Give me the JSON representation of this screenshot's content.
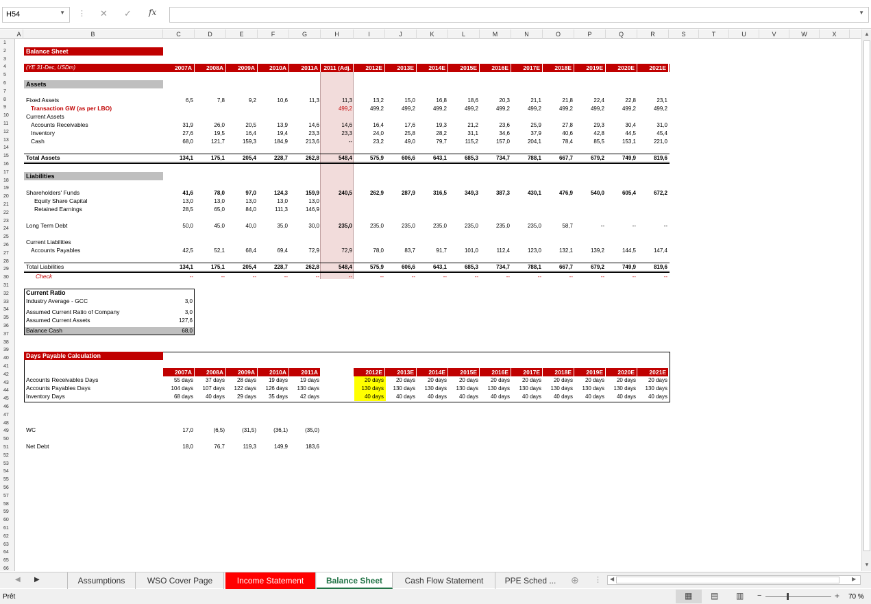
{
  "formula_bar": {
    "cell_ref": "H54",
    "fx": "fx",
    "value": ""
  },
  "columns": [
    "A",
    "B",
    "C",
    "D",
    "E",
    "F",
    "G",
    "H",
    "I",
    "J",
    "K",
    "L",
    "M",
    "N",
    "O",
    "P",
    "Q",
    "R",
    "S",
    "T",
    "U",
    "V",
    "W",
    "X"
  ],
  "rows": [
    "1",
    "2",
    "3",
    "4",
    "5",
    "6",
    "7",
    "8",
    "9",
    "10",
    "11",
    "12",
    "13",
    "14",
    "15",
    "16",
    "17",
    "18",
    "19",
    "20",
    "21",
    "22",
    "23",
    "24",
    "25",
    "26",
    "27",
    "28",
    "29",
    "30",
    "31",
    "32",
    "33",
    "34",
    "35",
    "36",
    "37",
    "38",
    "39",
    "40",
    "41",
    "42",
    "43",
    "44",
    "45",
    "46",
    "47",
    "48",
    "49",
    "50",
    "51",
    "52",
    "53",
    "54",
    "55",
    "56",
    "57",
    "58",
    "59",
    "60",
    "61",
    "62",
    "63",
    "64",
    "65",
    "66"
  ],
  "sheet": {
    "title": "Balance Sheet",
    "units": "(YE 31-Dec, USDm)",
    "years": [
      "2007A",
      "2008A",
      "2009A",
      "2010A",
      "2011A",
      "2011 (Adj.",
      "2012E",
      "2013E",
      "2014E",
      "2015E",
      "2016E",
      "2017E",
      "2018E",
      "2019E",
      "2020E",
      "2021E"
    ],
    "assets_label": "Assets",
    "fixed_assets": {
      "label": "Fixed Assets",
      "values": [
        "6,5",
        "7,8",
        "9,2",
        "10,6",
        "11,3",
        "11,3",
        "13,2",
        "15,0",
        "16,8",
        "18,6",
        "20,3",
        "21,1",
        "21,8",
        "22,4",
        "22,8",
        "23,1"
      ]
    },
    "transaction_gw": {
      "label": "Transaction GW (as per LBO)",
      "values": [
        "",
        "",
        "",
        "",
        "",
        "499,2",
        "499,2",
        "499,2",
        "499,2",
        "499,2",
        "499,2",
        "499,2",
        "499,2",
        "499,2",
        "499,2",
        "499,2"
      ]
    },
    "current_assets_label": "Current Assets",
    "receivables": {
      "label": "Accounts Receivables",
      "values": [
        "31,9",
        "26,0",
        "20,5",
        "13,9",
        "14,6",
        "14,6",
        "16,4",
        "17,6",
        "19,3",
        "21,2",
        "23,6",
        "25,9",
        "27,8",
        "29,3",
        "30,4",
        "31,0"
      ]
    },
    "inventory": {
      "label": "Inventory",
      "values": [
        "27,6",
        "19,5",
        "16,4",
        "19,4",
        "23,3",
        "23,3",
        "24,0",
        "25,8",
        "28,2",
        "31,1",
        "34,6",
        "37,9",
        "40,6",
        "42,8",
        "44,5",
        "45,4"
      ]
    },
    "cash": {
      "label": "Cash",
      "values": [
        "68,0",
        "121,7",
        "159,3",
        "184,9",
        "213,6",
        "--",
        "23,2",
        "49,0",
        "79,7",
        "115,2",
        "157,0",
        "204,1",
        "78,4",
        "85,5",
        "153,1",
        "221,0"
      ]
    },
    "total_assets": {
      "label": "Total Assets",
      "values": [
        "134,1",
        "175,1",
        "205,4",
        "228,7",
        "262,8",
        "548,4",
        "575,9",
        "606,6",
        "643,1",
        "685,3",
        "734,7",
        "788,1",
        "667,7",
        "679,2",
        "749,9",
        "819,6"
      ]
    },
    "liabilities_label": "Liabilities",
    "sh_funds": {
      "label": "Shareholders' Funds",
      "values": [
        "41,6",
        "78,0",
        "97,0",
        "124,3",
        "159,9",
        "240,5",
        "262,9",
        "287,9",
        "316,5",
        "349,3",
        "387,3",
        "430,1",
        "476,9",
        "540,0",
        "605,4",
        "672,2"
      ]
    },
    "equity_capital": {
      "label": "Equity Share Capital",
      "values": [
        "13,0",
        "13,0",
        "13,0",
        "13,0",
        "13,0"
      ]
    },
    "retained": {
      "label": "Retained Earnings",
      "values": [
        "28,5",
        "65,0",
        "84,0",
        "111,3",
        "146,9"
      ]
    },
    "ltd": {
      "label": "Long Term Debt",
      "values": [
        "50,0",
        "45,0",
        "40,0",
        "35,0",
        "30,0",
        "235,0",
        "235,0",
        "235,0",
        "235,0",
        "235,0",
        "235,0",
        "235,0",
        "58,7",
        "--",
        "--",
        "--"
      ]
    },
    "current_liab_label": "Current Liabilities",
    "payables": {
      "label": "Accounts Payables",
      "values": [
        "42,5",
        "52,1",
        "68,4",
        "69,4",
        "72,9",
        "72,9",
        "78,0",
        "83,7",
        "91,7",
        "101,0",
        "112,4",
        "123,0",
        "132,1",
        "139,2",
        "144,5",
        "147,4"
      ]
    },
    "total_liab": {
      "label": "Total Liabilities",
      "values": [
        "134,1",
        "175,1",
        "205,4",
        "228,7",
        "262,8",
        "548,4",
        "575,9",
        "606,6",
        "643,1",
        "685,3",
        "734,7",
        "788,1",
        "667,7",
        "679,2",
        "749,9",
        "819,6"
      ]
    },
    "check": {
      "label": "Check",
      "values": [
        "--",
        "--",
        "--",
        "--",
        "--",
        "--",
        "--",
        "--",
        "--",
        "--",
        "--",
        "--",
        "--",
        "--",
        "--",
        "--"
      ]
    }
  },
  "current_ratio": {
    "title": "Current Ratio",
    "industry": {
      "label": "Industry Average - GCC",
      "value": "3,0"
    },
    "assumed_ratio": {
      "label": "Assumed Current Ratio of Company",
      "value": "3,0"
    },
    "assumed_assets": {
      "label": "Assumed Current Assets",
      "value": "127,6"
    },
    "balance_cash": {
      "label": "Balance Cash",
      "value": "68,0"
    }
  },
  "days_payable": {
    "title": "Days Payable Calculation",
    "hist_years": [
      "2007A",
      "2008A",
      "2009A",
      "2010A",
      "2011A"
    ],
    "proj_years": [
      "2012E",
      "2013E",
      "2014E",
      "2015E",
      "2016E",
      "2017E",
      "2018E",
      "2019E",
      "2020E",
      "2021E"
    ],
    "recv": {
      "label": "Accounts Receivables Days",
      "hist": [
        "55 days",
        "37 days",
        "28 days",
        "19 days",
        "19 days"
      ],
      "proj": [
        "20 days",
        "20 days",
        "20 days",
        "20 days",
        "20 days",
        "20 days",
        "20 days",
        "20 days",
        "20 days",
        "20 days"
      ]
    },
    "pay": {
      "label": "Accounts Payables Days",
      "hist": [
        "104 days",
        "107 days",
        "122 days",
        "126 days",
        "130 days"
      ],
      "proj": [
        "130 days",
        "130 days",
        "130 days",
        "130 days",
        "130 days",
        "130 days",
        "130 days",
        "130 days",
        "130 days",
        "130 days"
      ]
    },
    "inv": {
      "label": "Inventory Days",
      "hist": [
        "68 days",
        "40 days",
        "29 days",
        "35 days",
        "42 days"
      ],
      "proj": [
        "40 days",
        "40 days",
        "40 days",
        "40 days",
        "40 days",
        "40 days",
        "40 days",
        "40 days",
        "40 days",
        "40 days"
      ]
    }
  },
  "wc": {
    "label": "WC",
    "values": [
      "17,0",
      "(6,5)",
      "(31,5)",
      "(36,1)",
      "(35,0)"
    ]
  },
  "net_debt": {
    "label": "Net Debt",
    "values": [
      "18,0",
      "76,7",
      "119,3",
      "149,9",
      "183,6"
    ]
  },
  "tabs": [
    "Assumptions",
    "WSO Cover Page",
    "Income Statement",
    "Balance Sheet",
    "Cash Flow Statement",
    "PPE Sched ..."
  ],
  "status": {
    "ready": "Prêt",
    "zoom": "70 %"
  }
}
